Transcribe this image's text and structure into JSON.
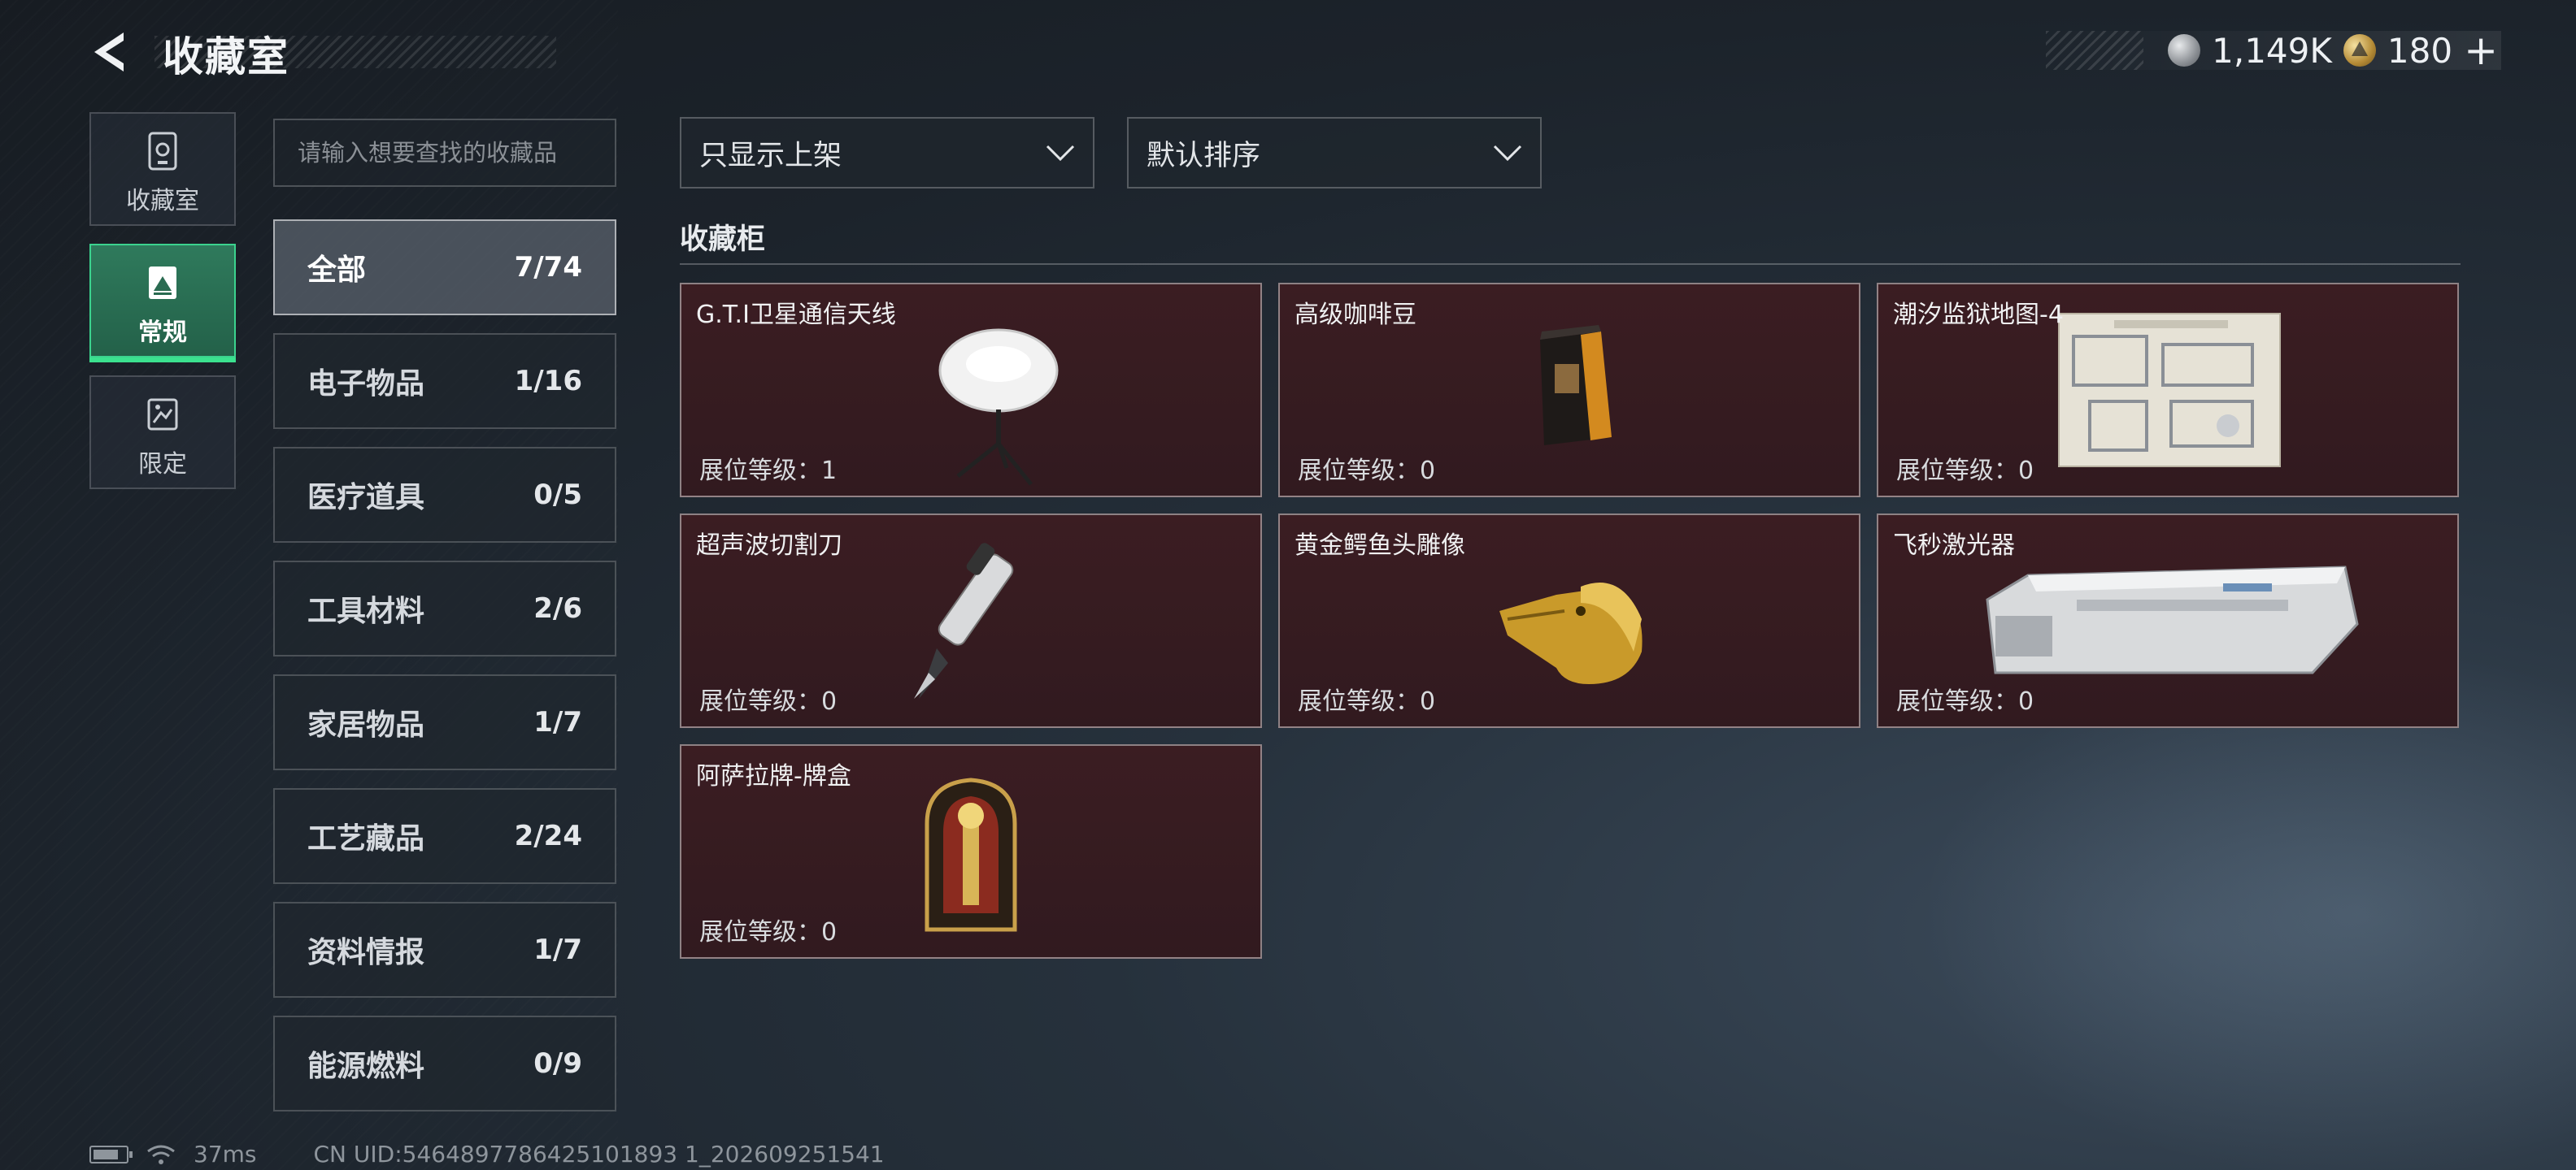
{
  "header": {
    "title": "收藏室"
  },
  "currency": {
    "silver": "1,149K",
    "gold": "180",
    "plus": "+"
  },
  "side_tabs": [
    {
      "label": "收藏室",
      "icon": "vault-icon"
    },
    {
      "label": "常规",
      "icon": "landscape-icon",
      "active": true
    },
    {
      "label": "限定",
      "icon": "limited-icon"
    }
  ],
  "search": {
    "placeholder": "请输入想要查找的收藏品"
  },
  "categories": [
    {
      "name": "全部",
      "count": "7/74",
      "active": true
    },
    {
      "name": "电子物品",
      "count": "1/16"
    },
    {
      "name": "医疗道具",
      "count": "0/5"
    },
    {
      "name": "工具材料",
      "count": "2/6"
    },
    {
      "name": "家居物品",
      "count": "1/7"
    },
    {
      "name": "工艺藏品",
      "count": "2/24"
    },
    {
      "name": "资料情报",
      "count": "1/7"
    },
    {
      "name": "能源燃料",
      "count": "0/9"
    }
  ],
  "filters": {
    "show": "只显示上架",
    "sort": "默认排序"
  },
  "section": {
    "title": "收藏柜"
  },
  "items": [
    {
      "name": "G.T.I卫星通信天线",
      "level": "展位等级：1"
    },
    {
      "name": "高级咖啡豆",
      "level": "展位等级：0"
    },
    {
      "name": "潮汐监狱地图-4",
      "level": "展位等级：0"
    },
    {
      "name": "超声波切割刀",
      "level": "展位等级：0"
    },
    {
      "name": "黄金鳄鱼头雕像",
      "level": "展位等级：0"
    },
    {
      "name": "飞秒激光器",
      "level": "展位等级：0"
    },
    {
      "name": "阿萨拉牌-牌盒",
      "level": "展位等级：0"
    }
  ],
  "footer": {
    "ping": "37ms",
    "uid": "CN UID:5464897786425101893 1_202609251541"
  },
  "colors": {
    "accent": "#3be28f",
    "card_bg": "#3b1d22"
  }
}
